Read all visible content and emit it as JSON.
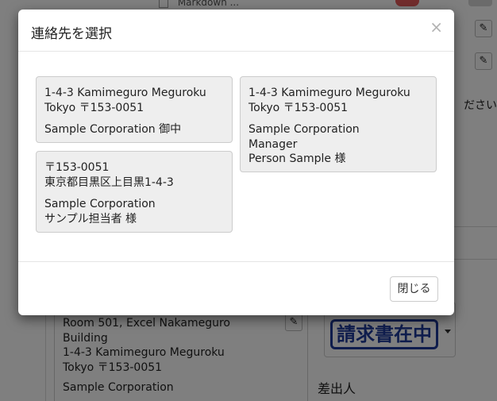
{
  "background": {
    "top_text": "Markdown ...",
    "right_text": "ださい。",
    "address_lines": [
      "Room 501, Excel Nakameguro",
      "Building",
      "1-4-3 Kamimeguro Meguroku",
      "Tokyo 〒153-0051"
    ],
    "address_company": "Sample Corporation",
    "stamp_text": "請求書在中",
    "sender_label": "差出人"
  },
  "modal": {
    "title": "連絡先を選択",
    "close_symbol": "×",
    "contacts": [
      {
        "lines": [
          "1-4-3 Kamimeguro Meguroku",
          "Tokyo 〒153-0051"
        ],
        "name_lines": [
          "Sample Corporation 御中"
        ]
      },
      {
        "lines": [
          "1-4-3 Kamimeguro Meguroku",
          "Tokyo 〒153-0051"
        ],
        "name_lines": [
          "Sample Corporation",
          "Manager",
          "Person Sample 様"
        ]
      },
      {
        "lines": [
          "〒153-0051",
          "東京都目黒区上目黒1-4-3"
        ],
        "name_lines": [
          "Sample Corporation",
          "サンプル担当者 様"
        ]
      }
    ],
    "close_button_label": "閉じる"
  },
  "icons": {
    "pencil": "✎"
  }
}
